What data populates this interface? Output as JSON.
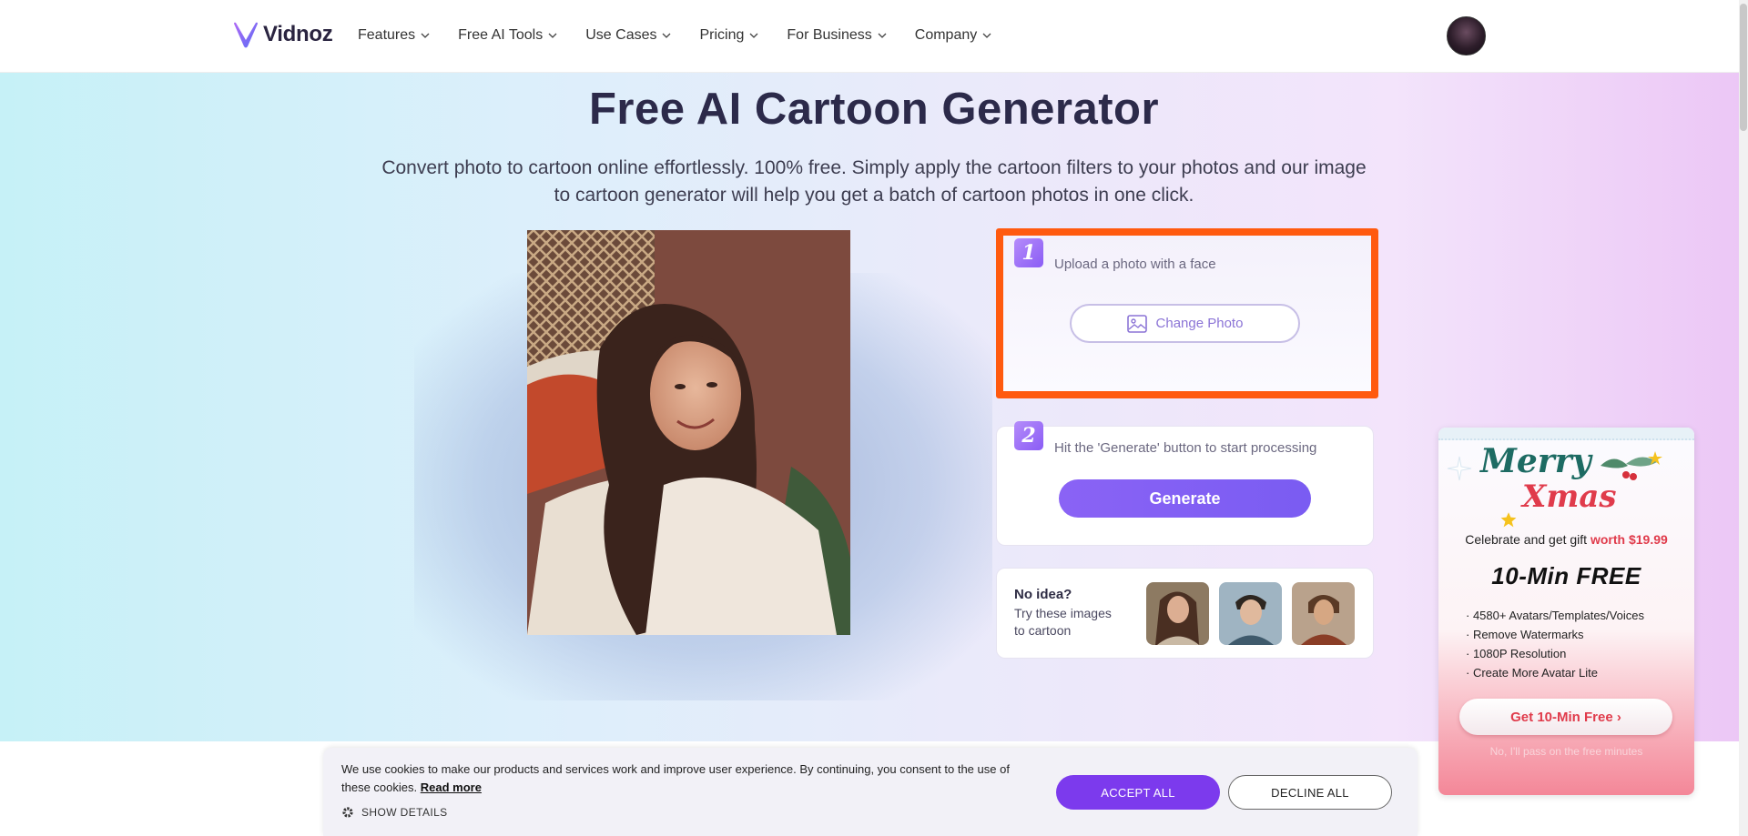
{
  "header": {
    "logo_text": "Vidnoz",
    "nav": [
      {
        "label": "Features"
      },
      {
        "label": "Free AI Tools"
      },
      {
        "label": "Use Cases"
      },
      {
        "label": "Pricing"
      },
      {
        "label": "For Business"
      },
      {
        "label": "Company"
      }
    ]
  },
  "hero": {
    "title": "Free AI Cartoon Generator",
    "subtitle": "Convert photo to cartoon online effortlessly. 100% free. Simply apply the cartoon filters to your photos and our image to cartoon generator will help you get a batch of cartoon photos in one click."
  },
  "steps": {
    "step1": {
      "number": "1",
      "text": "Upload a photo with a face",
      "button": "Change Photo"
    },
    "step2": {
      "number": "2",
      "text": "Hit the 'Generate' button to start processing",
      "button": "Generate"
    },
    "samples": {
      "title": "No idea?",
      "text": "Try these images to cartoon"
    }
  },
  "promo": {
    "line1": "Merry",
    "line2": "Xmas",
    "celebrate": "Celebrate and get gift",
    "worth": "worth $19.99",
    "headline": "10-Min FREE",
    "perks": [
      "· 4580+ Avatars/Templates/Voices",
      "· Remove Watermarks",
      "· 1080P Resolution",
      "· Create More Avatar Lite"
    ],
    "button": "Get 10-Min Free ›",
    "dismiss": "No, I'll pass on the free minutes"
  },
  "cookie": {
    "text": "We use cookies to make our products and services work and improve user experience. By continuing, you consent to the use of these cookies.",
    "link": "Read more",
    "details": "SHOW DETAILS",
    "accept": "ACCEPT ALL",
    "decline": "DECLINE ALL"
  },
  "colors": {
    "accent": "#7c5cf3",
    "highlight_frame": "#ff5a0f",
    "promo_red": "#e03b4b"
  }
}
